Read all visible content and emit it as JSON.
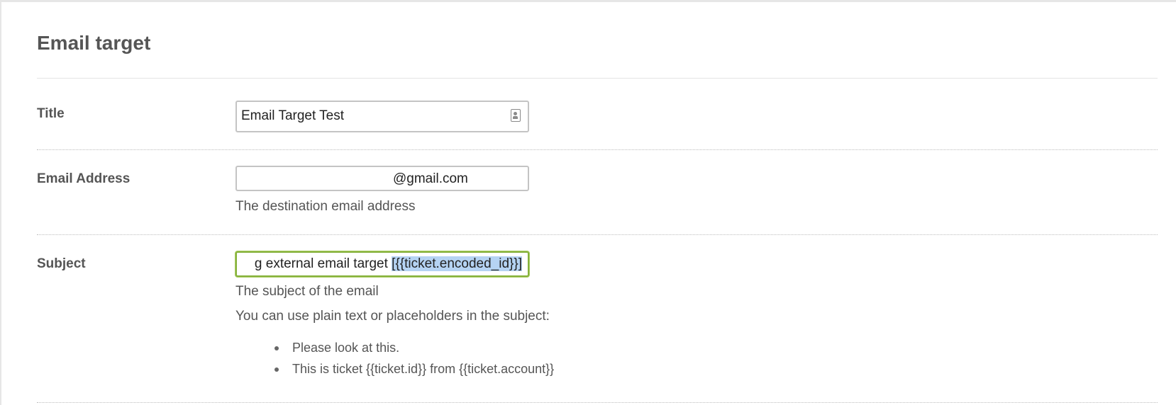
{
  "header": {
    "title": "Email target"
  },
  "fields": {
    "title": {
      "label": "Title",
      "value": "Email Target Test"
    },
    "email": {
      "label": "Email Address",
      "value": "@gmail.com",
      "help": "The destination email address"
    },
    "subject": {
      "label": "Subject",
      "value_visible_prefix": "g external email target ",
      "value_selected": "[{{ticket.encoded_id}}]",
      "help": "The subject of the email",
      "hint": "You can use plain text or placeholders in the subject:",
      "examples": [
        "Please look at this.",
        "This is ticket {{ticket.id}} from {{ticket.account}}"
      ]
    }
  },
  "colors": {
    "focus_border": "#86b13c",
    "selection": "#b5d3f3"
  }
}
